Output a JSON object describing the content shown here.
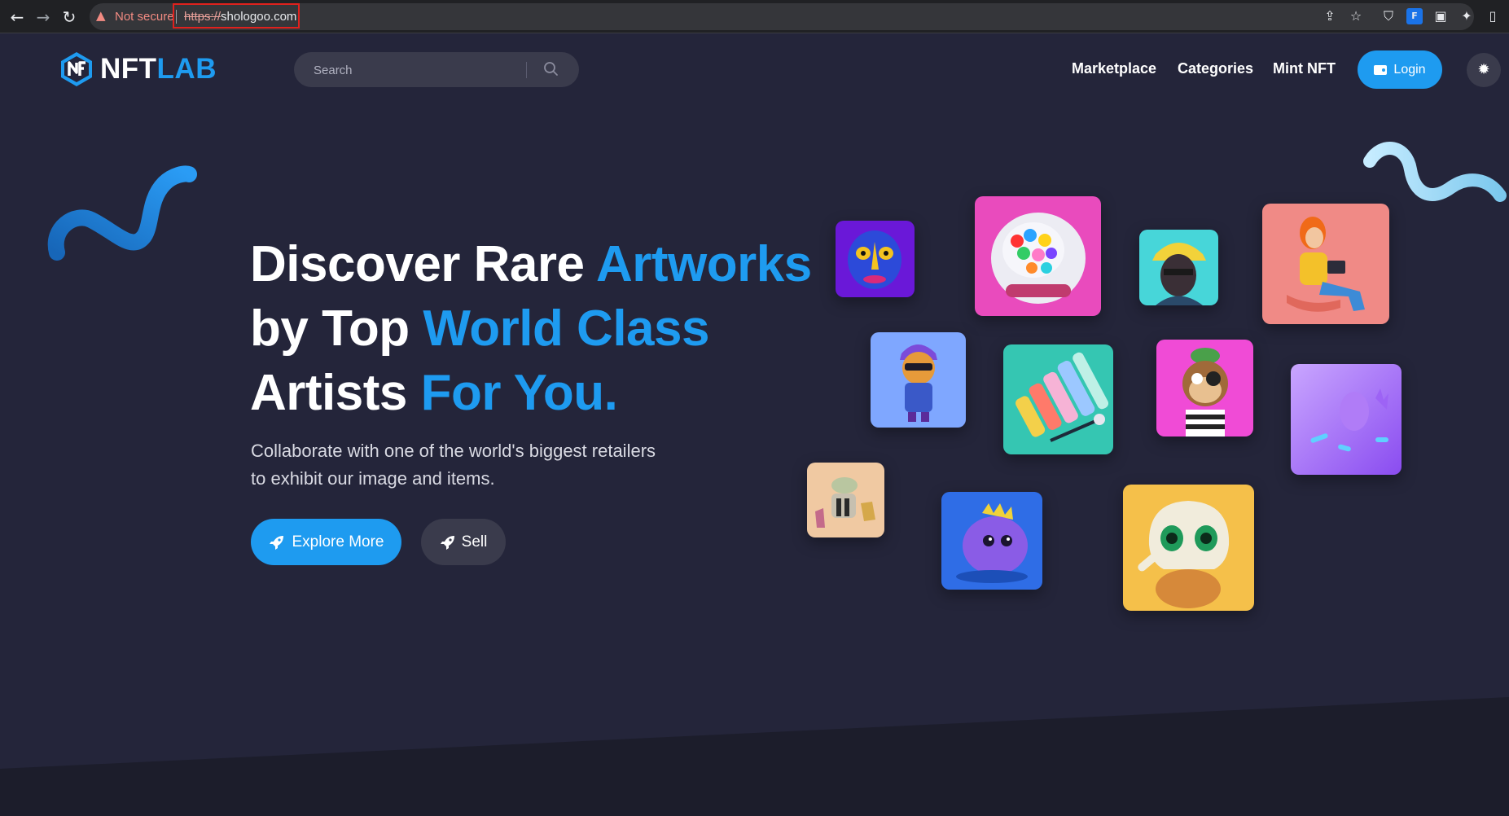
{
  "browser": {
    "security_label": "Not secure",
    "url_scheme": "https://",
    "url_host": "shologoo.com"
  },
  "site": {
    "logo_text_a": "NFT",
    "logo_text_b": "LAB",
    "search_placeholder": "Search",
    "nav": [
      "Marketplace",
      "Categories",
      "Mint NFT"
    ],
    "login_label": "Login"
  },
  "hero": {
    "title_line1_a": "Discover Rare ",
    "title_line1_b": "Artworks",
    "title_line2_a": "by Top ",
    "title_line2_b": "World Class",
    "title_line3_a": "Artists ",
    "title_line3_b": "For You.",
    "subtitle_line1": "Collaborate with one of the world's biggest retailers",
    "subtitle_line2": "to exhibit our image and items.",
    "explore_label": "Explore More",
    "sell_label": "Sell"
  },
  "colors": {
    "background": "#24253a",
    "accent": "#1e9bf0",
    "surface": "#3a3b4c"
  },
  "icons": [
    "back-icon",
    "forward-icon",
    "reload-icon",
    "warning-icon",
    "share-icon",
    "star-icon",
    "shield-extension-icon",
    "extension-icon",
    "puzzle-icon",
    "sidebar-icon",
    "search-icon",
    "wallet-icon",
    "gear-icon",
    "rocket-icon"
  ]
}
